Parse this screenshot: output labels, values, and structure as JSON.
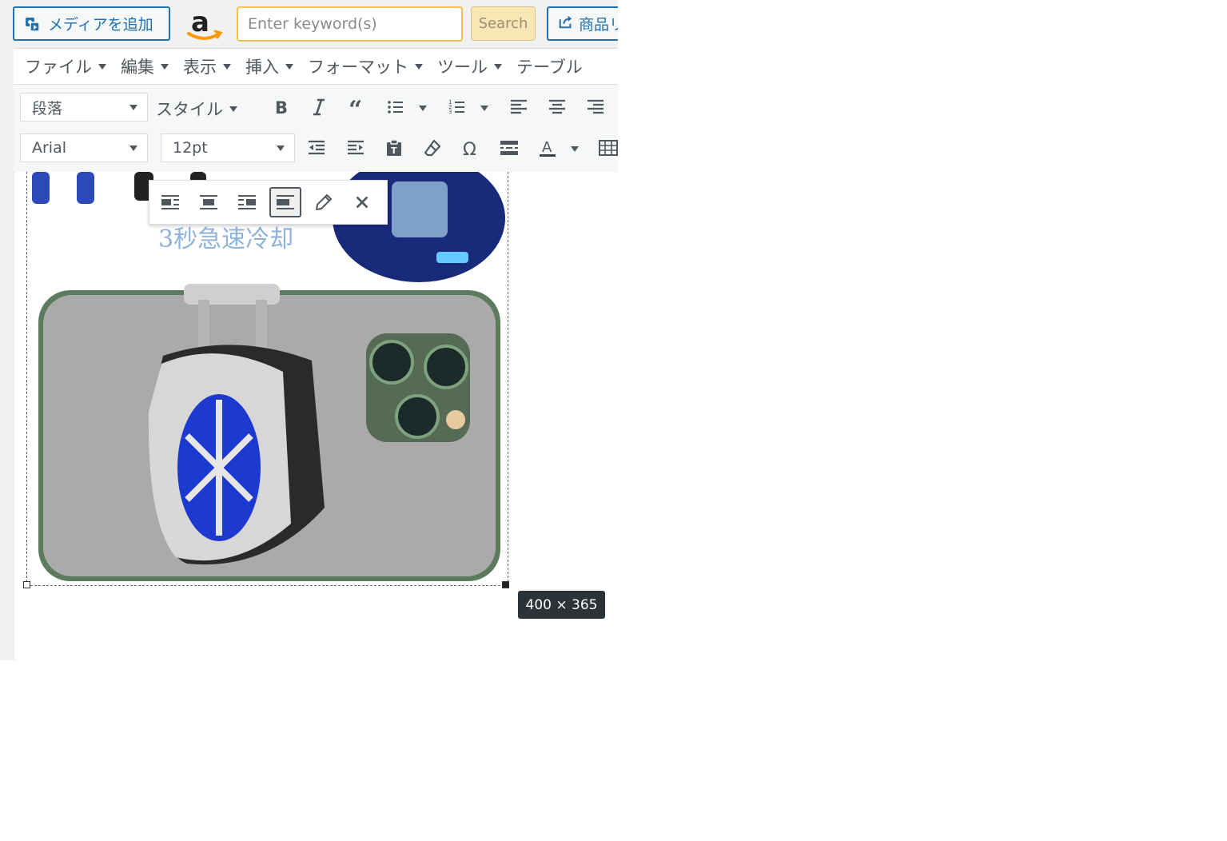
{
  "header": {
    "media_button_label": "メディアを追加",
    "keyword_placeholder": "Enter keyword(s)",
    "search_label": "Search",
    "product_button_label": "商品リ"
  },
  "menubar": {
    "items": [
      {
        "label": "ファイル"
      },
      {
        "label": "編集"
      },
      {
        "label": "表示"
      },
      {
        "label": "挿入"
      },
      {
        "label": "フォーマット"
      },
      {
        "label": "ツール"
      },
      {
        "label": "テーブル"
      }
    ]
  },
  "toolbar": {
    "format_select": "段落",
    "style_label": "スタイル",
    "font_select": "Arial",
    "size_select": "12pt",
    "text_color_letter": "A"
  },
  "image": {
    "overlay_text": "3秒急速冷却",
    "dimensions": "400 × 365"
  },
  "colors": {
    "accent": "#2271b1",
    "search_bg": "#f8e6b4",
    "search_border": "#f0c14b",
    "tooltip_bg": "#2c3338"
  }
}
